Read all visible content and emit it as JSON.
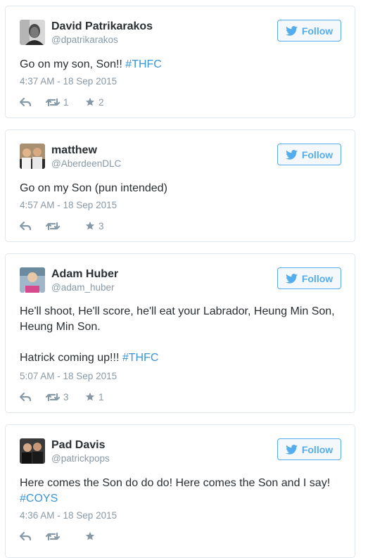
{
  "icons": {
    "reply": "reply-icon",
    "retweet": "retweet-icon",
    "favorite": "star-icon",
    "follow_bird": "twitter-bird-icon"
  },
  "colors": {
    "twitter_blue": "#55acee",
    "link_blue": "#3b94d9",
    "meta_gray": "#8899a6",
    "border": "#e1e8ed"
  },
  "tweets": [
    {
      "name": "David Patrikarakos",
      "handle": "@dpatrikarakos",
      "follow_label": "Follow",
      "text_plain": "Go on my son, Son!! ",
      "hashtag": "#THFC",
      "timestamp": "4:37 AM - 18 Sep 2015",
      "retweets": "1",
      "favorites": "2"
    },
    {
      "name": "matthew",
      "handle": "@AberdeenDLC",
      "follow_label": "Follow",
      "text_plain": "Go on my Son (pun intended)",
      "timestamp": "4:57 AM - 18 Sep 2015",
      "retweets": "",
      "favorites": "3"
    },
    {
      "name": "Adam Huber",
      "handle": "@adam_huber",
      "follow_label": "Follow",
      "text_line1": "He'll shoot, He'll score, he'll eat your Labrador, Heung Min Son, Heung Min Son.",
      "text_line2_plain": "Hatrick coming up!!! ",
      "hashtag": "#THFC",
      "timestamp": "5:07 AM - 18 Sep 2015",
      "retweets": "3",
      "favorites": "1"
    },
    {
      "name": "Pad Davis",
      "handle": "@patrickpops",
      "follow_label": "Follow",
      "text_plain": "Here comes the Son do do do! Here comes the Son and I say! ",
      "hashtag": "#COYS",
      "timestamp": "4:36 AM - 18 Sep 2015",
      "retweets": "",
      "favorites": ""
    }
  ]
}
